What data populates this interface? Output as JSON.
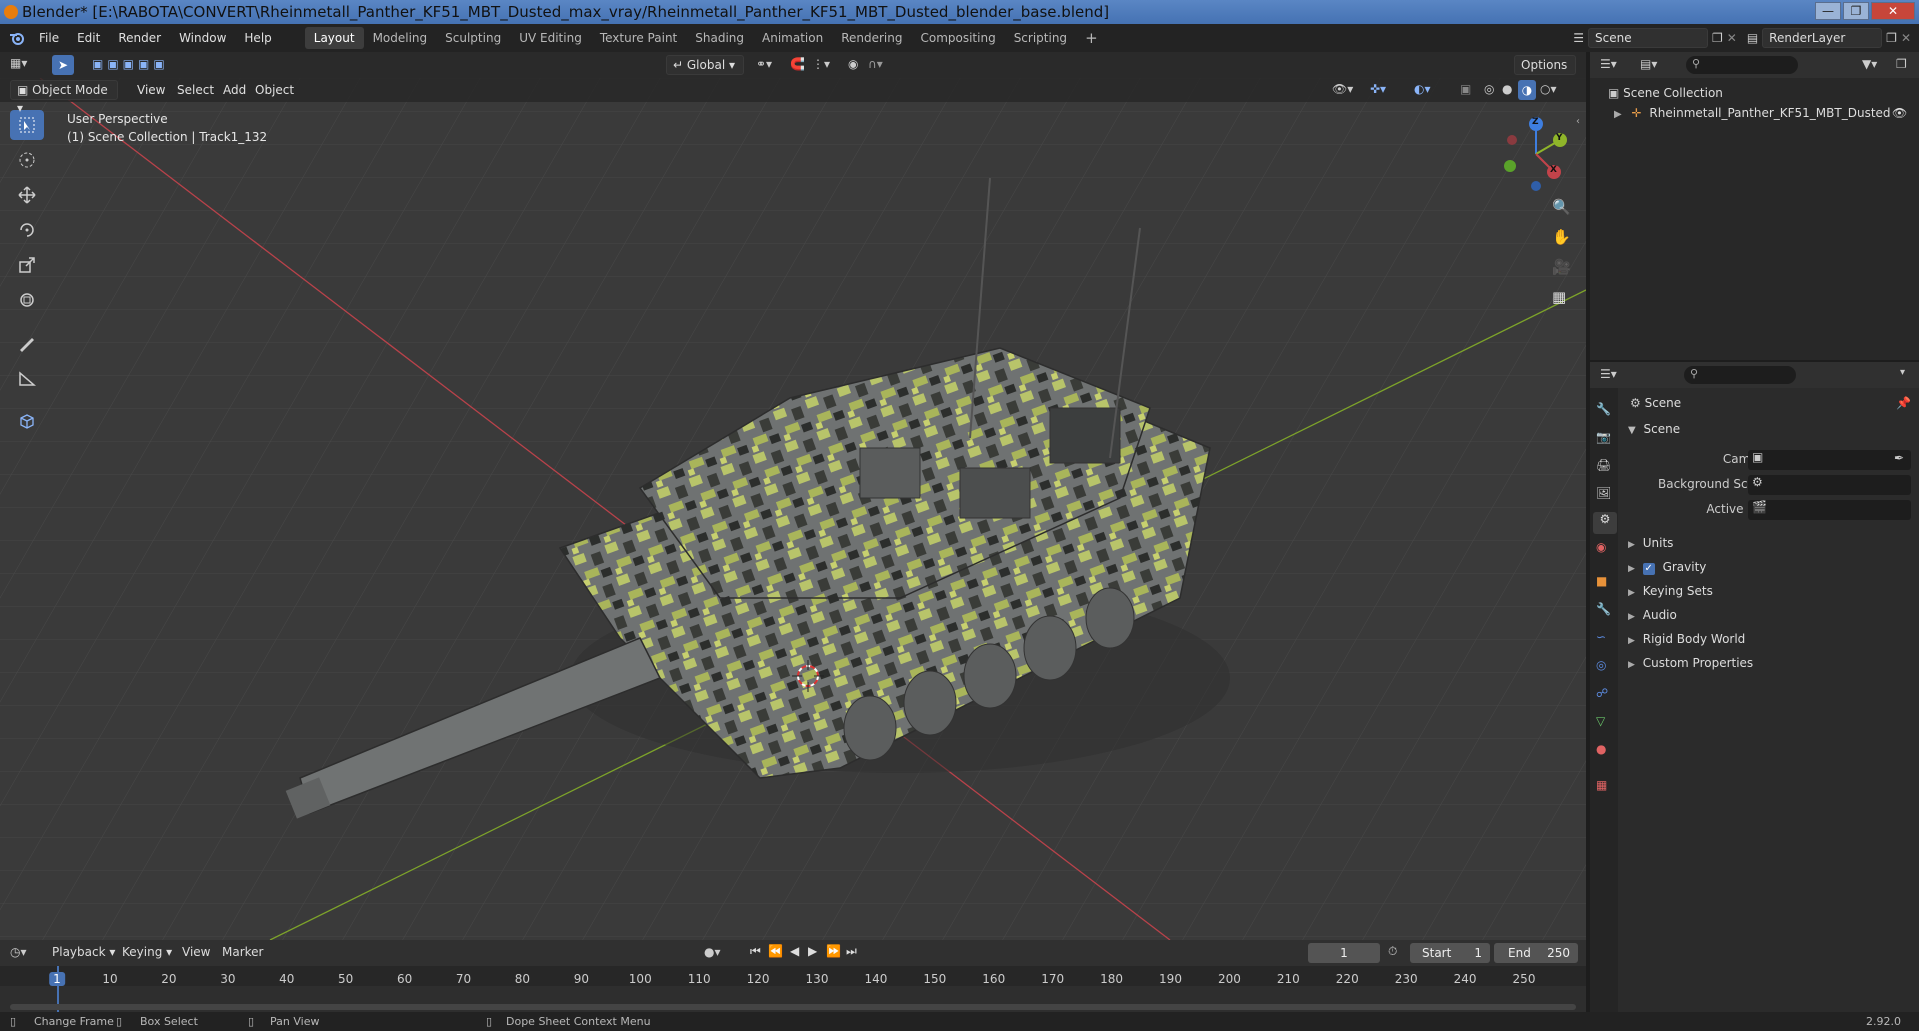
{
  "window": {
    "title": "Blender* [E:\\RABOTA\\CONVERT\\Rheinmetall_Panther_KF51_MBT_Dusted_max_vray/Rheinmetall_Panther_KF51_MBT_Dusted_blender_base.blend]"
  },
  "menu": [
    "File",
    "Edit",
    "Render",
    "Window",
    "Help"
  ],
  "workspaces": [
    "Layout",
    "Modeling",
    "Sculpting",
    "UV Editing",
    "Texture Paint",
    "Shading",
    "Animation",
    "Rendering",
    "Compositing",
    "Scripting"
  ],
  "scene_selector": {
    "scene": "Scene",
    "render_layer": "RenderLayer"
  },
  "viewport_header": {
    "mode": "Object Mode",
    "menus": [
      "View",
      "Select",
      "Add",
      "Object"
    ],
    "transform_orientation": "Global",
    "options": "Options"
  },
  "viewport": {
    "perspective": "User Perspective",
    "collection_info": "(1) Scene Collection | Track1_132"
  },
  "gizmo_axes": {
    "z": "Z",
    "y": "Y",
    "x": "X"
  },
  "outliner": {
    "root": "Scene Collection",
    "items": [
      {
        "label": "Rheinmetall_Panther_KF51_MBT_Dusted"
      }
    ]
  },
  "properties": {
    "context": "Scene",
    "panel_title": "Scene",
    "fields": [
      {
        "label": "Camera"
      },
      {
        "label": "Background Scene"
      },
      {
        "label": "Active Clip"
      }
    ],
    "sections": [
      "Units",
      "Gravity",
      "Keying Sets",
      "Audio",
      "Rigid Body World",
      "Custom Properties"
    ],
    "gravity_checked": true
  },
  "timeline": {
    "menus": [
      "Playback",
      "Keying",
      "View",
      "Marker"
    ],
    "current_frame": "1",
    "start_label": "Start",
    "start": "1",
    "end_label": "End",
    "end": "250",
    "ruler": [
      "1",
      "10",
      "20",
      "30",
      "40",
      "50",
      "60",
      "70",
      "80",
      "90",
      "100",
      "110",
      "120",
      "130",
      "140",
      "150",
      "160",
      "170",
      "180",
      "190",
      "200",
      "210",
      "220",
      "230",
      "240",
      "250"
    ]
  },
  "statusbar": {
    "items": [
      "Change Frame",
      "Box Select",
      "Pan View",
      "Dope Sheet Context Menu"
    ],
    "version": "2.92.0"
  },
  "colors": {
    "accent": "#4772b3",
    "x_axis": "#c2434a",
    "y_axis": "#8fb52a",
    "z_axis": "#3e7ee0"
  }
}
